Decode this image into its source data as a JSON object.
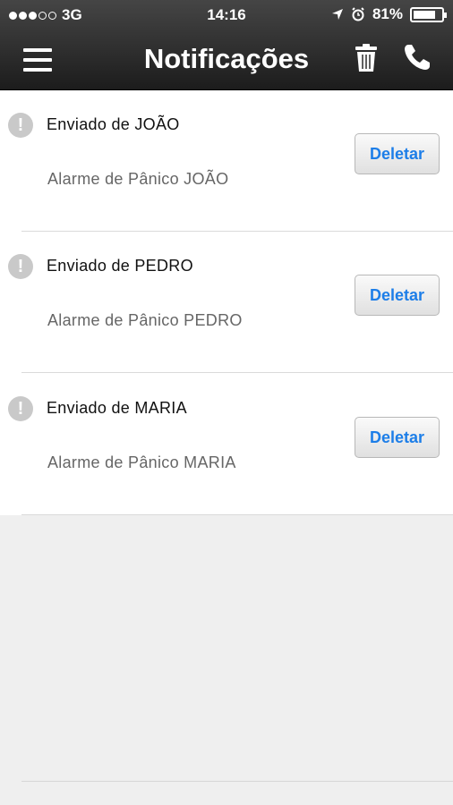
{
  "status_bar": {
    "carrier": "3G",
    "time": "14:16",
    "battery": "81%",
    "battery_level": 0.81
  },
  "header": {
    "title": "Notificações",
    "icons": [
      "menu-icon",
      "trash-icon",
      "phone-icon"
    ]
  },
  "notifications": [
    {
      "title": "Enviado de JOÃO",
      "message": "Alarme de Pânico JOÃO",
      "action": "Deletar"
    },
    {
      "title": "Enviado de PEDRO",
      "message": "Alarme de Pânico PEDRO",
      "action": "Deletar"
    },
    {
      "title": "Enviado de MARIA",
      "message": "Alarme de Pânico MARIA",
      "action": "Deletar"
    }
  ],
  "colors": {
    "accent": "#1d7ee8",
    "header": "#2f2f2f",
    "background": "#efefef"
  }
}
